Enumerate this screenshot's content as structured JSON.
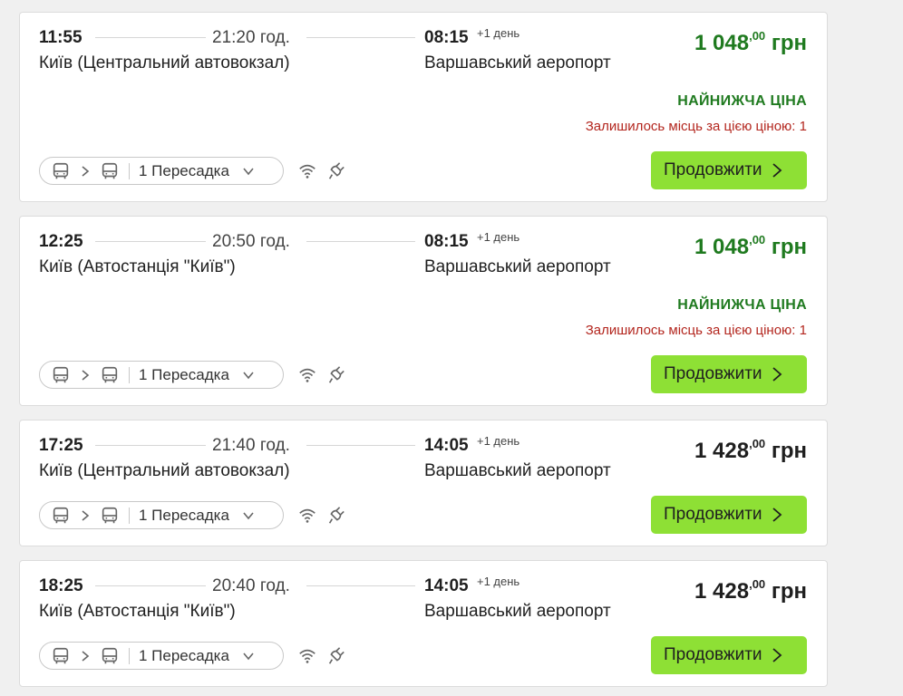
{
  "currency": "грн",
  "continue_label": "Продовжити",
  "lowest_price_label": "НАЙНИЖЧА ЦІНА",
  "plus_day_label": "+1 день",
  "colors": {
    "accent_button": "#8ee035",
    "price_green": "#1f7a1f",
    "warning_red": "#b3261e"
  },
  "trips": [
    {
      "departure_time": "11:55",
      "duration": "21:20 год.",
      "arrival_time": "08:15",
      "departure_station": "Київ (Центральний автовокзал)",
      "arrival_station": "Варшавський аеропорт",
      "price_main": "1 048",
      "price_cents": ",00",
      "highlight": "lowest",
      "seats_left": "Залишилось місць за цією ціною: 1",
      "transfers": "1 Пересадка",
      "amenities": [
        "wifi-icon",
        "plug-icon"
      ]
    },
    {
      "departure_time": "12:25",
      "duration": "20:50 год.",
      "arrival_time": "08:15",
      "departure_station": "Київ (Автостанція \"Київ\")",
      "arrival_station": "Варшавський аеропорт",
      "price_main": "1 048",
      "price_cents": ",00",
      "highlight": "lowest",
      "seats_left": "Залишилось місць за цією ціною: 1",
      "transfers": "1 Пересадка",
      "amenities": [
        "wifi-icon",
        "plug-icon"
      ]
    },
    {
      "departure_time": "17:25",
      "duration": "21:40 год.",
      "arrival_time": "14:05",
      "departure_station": "Київ (Центральний автовокзал)",
      "arrival_station": "Варшавський аеропорт",
      "price_main": "1 428",
      "price_cents": ",00",
      "highlight": "none",
      "transfers": "1 Пересадка",
      "amenities": [
        "wifi-icon",
        "plug-icon"
      ]
    },
    {
      "departure_time": "18:25",
      "duration": "20:40 год.",
      "arrival_time": "14:05",
      "departure_station": "Київ (Автостанція \"Київ\")",
      "arrival_station": "Варшавський аеропорт",
      "price_main": "1 428",
      "price_cents": ",00",
      "highlight": "none",
      "transfers": "1 Пересадка",
      "amenities": [
        "wifi-icon",
        "plug-icon"
      ]
    }
  ]
}
